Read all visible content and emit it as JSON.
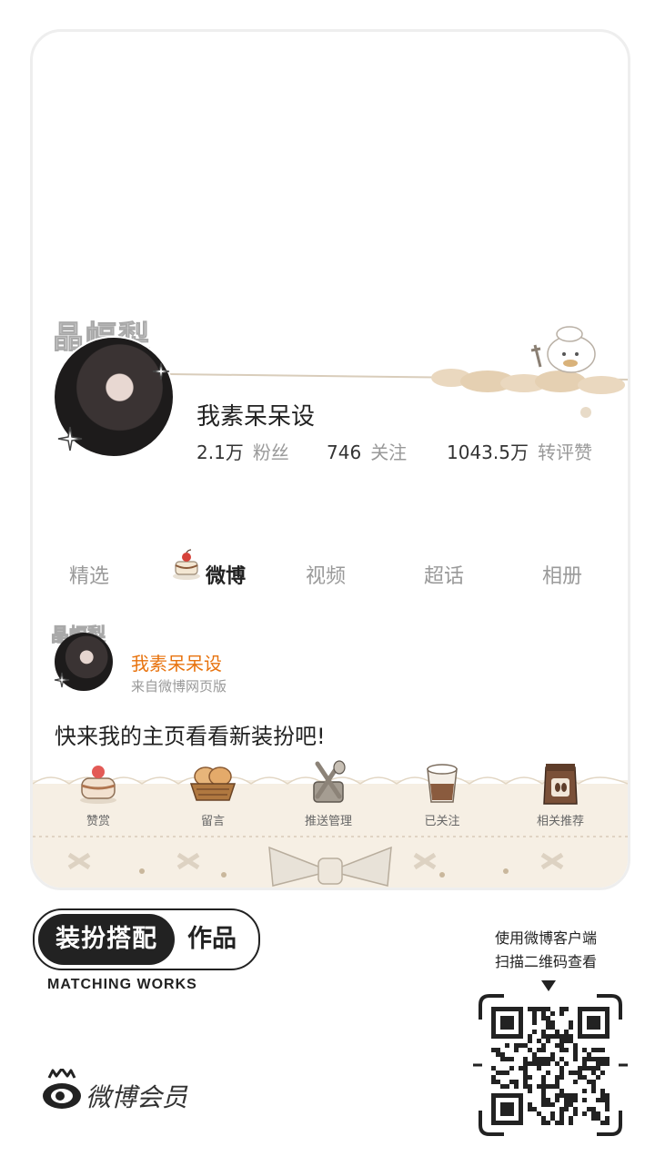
{
  "profile": {
    "avatar_frame_text": "晶幅梨",
    "name": "我素呆呆设",
    "stats": [
      {
        "value": "2.1万",
        "label": "粉丝"
      },
      {
        "value": "746",
        "label": "关注"
      },
      {
        "value": "1043.5万",
        "label": "转评赞"
      }
    ]
  },
  "tabs": [
    "精选",
    "微博",
    "视频",
    "超话",
    "相册"
  ],
  "active_tab": "微博",
  "post": {
    "avatar_frame_text": "晶幅梨",
    "author": "我素呆呆设",
    "source": "来自微博网页版",
    "text": "快来我的主页看看新装扮吧!"
  },
  "actions": [
    {
      "label": "赞赏",
      "icon": "cake-icon"
    },
    {
      "label": "留言",
      "icon": "bread-basket-icon"
    },
    {
      "label": "推送管理",
      "icon": "cutlery-icon"
    },
    {
      "label": "已关注",
      "icon": "coffee-cup-icon"
    },
    {
      "label": "相关推荐",
      "icon": "coffee-bag-icon"
    }
  ],
  "badge": {
    "dark_text": "装扮搭配",
    "light_text": "作品",
    "subtitle": "MATCHING WORKS"
  },
  "brand": {
    "text": "微博会员",
    "icon": "weibo-eye-icon"
  },
  "qr": {
    "hint_line1": "使用微博客户端",
    "hint_line2": "扫描二维码查看",
    "icon": "qr-code-icon"
  },
  "colors": {
    "accent_orange": "#e8730e",
    "cream": "#efe4d2",
    "border": "#eeeeee"
  }
}
